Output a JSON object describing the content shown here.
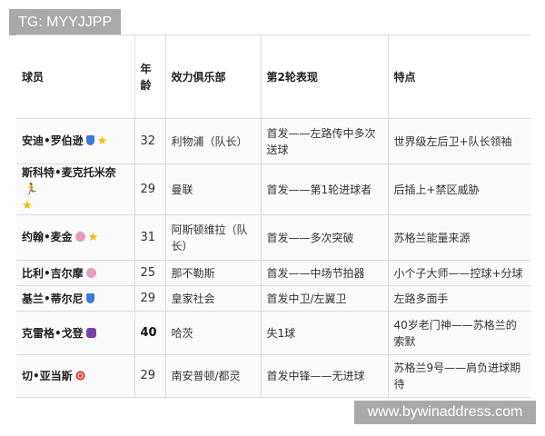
{
  "tag": "TG: MYYJJPP",
  "watermark": "www.bywinaddress.com",
  "table": {
    "headers": [
      "球员",
      "年龄",
      "效力俱乐部",
      "第2轮表现",
      "特点"
    ],
    "rows": [
      {
        "name": "安迪•罗伯逊",
        "icons": [
          "shield-icon",
          "star-icon"
        ],
        "age": "32",
        "club": "利物浦（队长）",
        "performance": "首发——左路传中多次送球",
        "trait": "世界级左后卫+队长领袖"
      },
      {
        "name": "斯科特•麦克托米奈",
        "icons": [
          "runner-icon",
          "star-icon"
        ],
        "age": "29",
        "club": "曼联",
        "performance": "首发——第1轮进球者",
        "trait": "后插上+禁区威胁"
      },
      {
        "name": "约翰•麦金",
        "icons": [
          "brain-icon",
          "star-icon"
        ],
        "age": "31",
        "club": "阿斯顿维拉（队长）",
        "performance": "首发——多次突破",
        "trait": "苏格兰能量来源"
      },
      {
        "name": "比利•吉尔摩",
        "icons": [
          "brain-icon"
        ],
        "age": "25",
        "club": "那不勒斯",
        "performance": "首发——中场节拍器",
        "trait": "小个子大师——控球+分球"
      },
      {
        "name": "基兰•蒂尔尼",
        "icons": [
          "shield-icon"
        ],
        "age": "29",
        "club": "皇家社会",
        "performance": "首发中卫/左翼卫",
        "trait": "左路多面手"
      },
      {
        "name": "克雷格•戈登",
        "icons": [
          "gem-icon"
        ],
        "age": "40",
        "club": "哈茨",
        "performance": "失1球",
        "trait": "40岁老门神——苏格兰的索默"
      },
      {
        "name": "切•亚当斯",
        "icons": [
          "target-icon"
        ],
        "age": "29",
        "club": "南安普顿/都灵",
        "performance": "首发中锋——无进球",
        "trait": "苏格兰9号——肩负进球期待"
      }
    ]
  }
}
